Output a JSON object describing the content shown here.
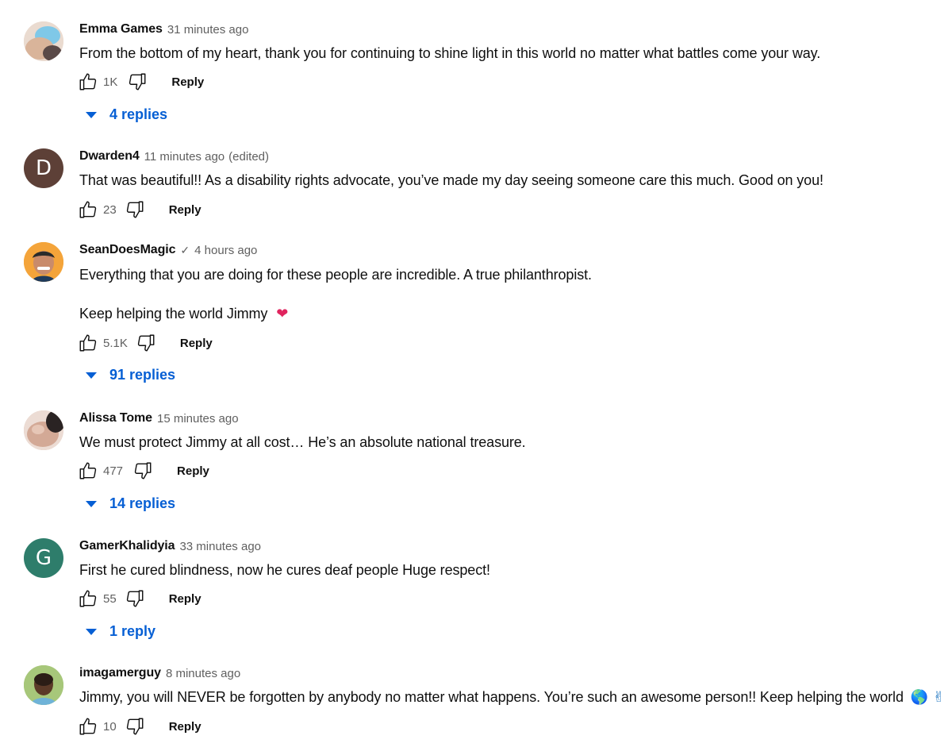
{
  "comments": [
    {
      "author": "Emma Games",
      "time": "31 minutes ago",
      "lines": [
        "From the bottom of my heart, thank you for continuing to shine light in this world no matter what battles come your way."
      ],
      "likes": "1K",
      "reply_label": "Reply",
      "replies": "4 replies"
    },
    {
      "author": "Dwarden4",
      "time": "11 minutes ago",
      "edited": "(edited)",
      "avatar_letter": "D",
      "avatar_color": "#5d4037",
      "lines": [
        "That was beautiful!! As a disability rights advocate, you’ve made my day seeing someone care this much. Good on you!"
      ],
      "likes": "23",
      "reply_label": "Reply"
    },
    {
      "author": "SeanDoesMagic",
      "verified_icon": "✓",
      "time": "4 hours ago",
      "lines": [
        "Everything that you are doing for these people are incredible. A true philanthropist.",
        "Keep helping the world Jimmy"
      ],
      "emoji": "❤",
      "likes": "5.1K",
      "reply_label": "Reply",
      "replies": "91 replies"
    },
    {
      "author": "Alissa Tome",
      "time": "15 minutes ago",
      "lines": [
        "We must protect Jimmy at all cost… He’s an absolute national treasure."
      ],
      "likes": "477",
      "reply_label": "Reply",
      "replies": "14 replies"
    },
    {
      "author": "GamerKhalidyia",
      "time": "33 minutes ago",
      "avatar_letter": "G",
      "avatar_color": "#2e7d6b",
      "lines": [
        "First he cured blindness, now he cures deaf people Huge respect!"
      ],
      "likes": "55",
      "reply_label": "Reply",
      "replies": "1 reply"
    },
    {
      "author": "imagamerguy",
      "time": "8 minutes ago",
      "lines": [
        "Jimmy, you will NEVER be forgotten by anybody no matter what happens.  You’re such an awesome person!! Keep helping the world"
      ],
      "emoji": "🌎 ✌",
      "likes": "10",
      "reply_label": "Reply"
    }
  ],
  "colors": {
    "link": "#065fd4",
    "meta": "#606060",
    "text": "#0f0f0f"
  }
}
